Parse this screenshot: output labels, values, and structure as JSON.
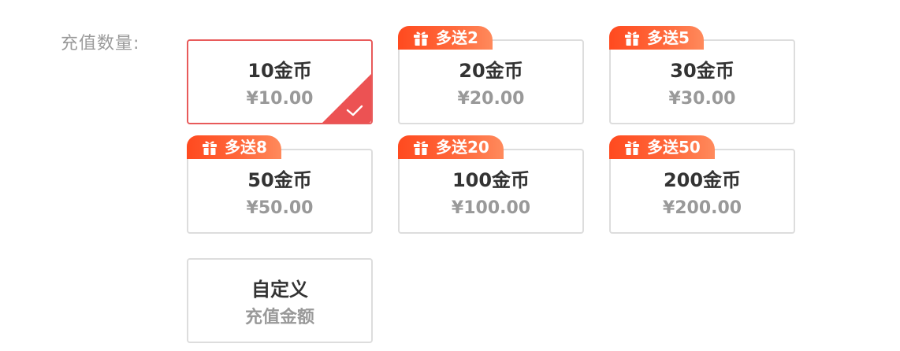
{
  "form": {
    "label": "充值数量:"
  },
  "options": [
    {
      "title": "10金币",
      "price": "¥10.00",
      "badge": "",
      "selected": true
    },
    {
      "title": "20金币",
      "price": "¥20.00",
      "badge": "多送2",
      "selected": false
    },
    {
      "title": "30金币",
      "price": "¥30.00",
      "badge": "多送5",
      "selected": false
    },
    {
      "title": "50金币",
      "price": "¥50.00",
      "badge": "多送8",
      "selected": false
    },
    {
      "title": "100金币",
      "price": "¥100.00",
      "badge": "多送20",
      "selected": false
    },
    {
      "title": "200金币",
      "price": "¥200.00",
      "badge": "多送50",
      "selected": false
    },
    {
      "title": "自定义",
      "price": "充值金额",
      "badge": "",
      "selected": false
    }
  ],
  "icons": {
    "badge_icon": "gift-icon",
    "selected_icon": "check-icon"
  },
  "colors": {
    "selected_border": "#e85a5a",
    "selected_corner": "#ec5253",
    "badge_gradient_start": "#ff4a1f",
    "badge_gradient_end": "#ff8a5c",
    "title_text": "#333333",
    "sub_text": "#999999",
    "label_text": "#9a9a9a"
  }
}
